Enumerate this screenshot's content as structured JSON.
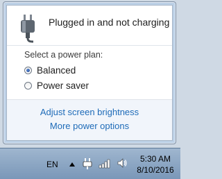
{
  "flyout": {
    "status": "Plugged in and not charging",
    "plan_heading": "Select a power plan:",
    "plans": [
      {
        "label": "Balanced",
        "selected": true
      },
      {
        "label": "Power saver",
        "selected": false
      }
    ],
    "links": {
      "brightness": "Adjust screen brightness",
      "more_options": "More power options"
    }
  },
  "taskbar": {
    "language": "EN",
    "time": "5:30 AM",
    "date": "8/10/2016",
    "icons": [
      "show-hidden-icons-arrow",
      "power-plug-icon",
      "network-signal-icon",
      "speaker-volume-icon"
    ]
  },
  "colors": {
    "link": "#1e6bb8",
    "taskbar": "#8aa6c4"
  }
}
